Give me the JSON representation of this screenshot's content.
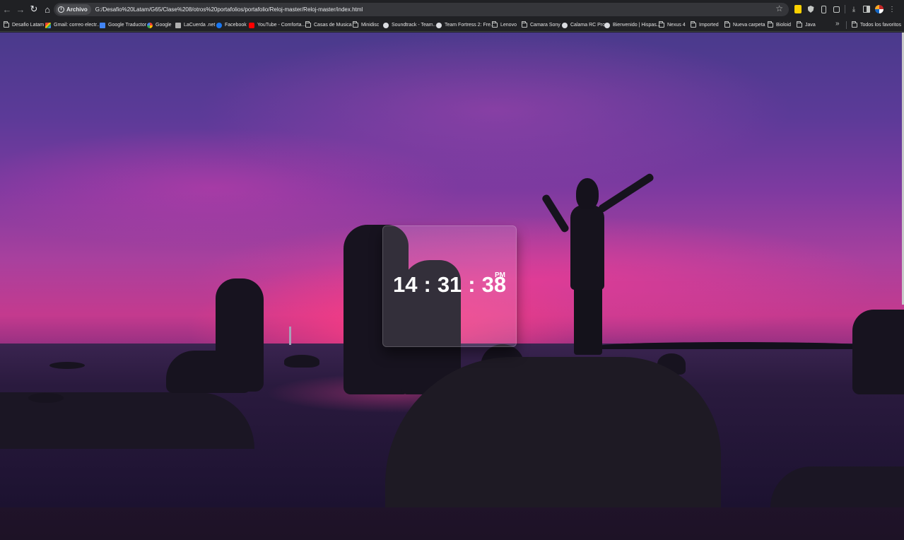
{
  "browser": {
    "chip_label": "Archivo",
    "url": "G:/Desafio%20Latam/G65/Clase%208/otros%20portafolios/portafolio/Reloj-master/Reloj-master/index.html"
  },
  "bookmarks": [
    {
      "label": "Desafio Latam",
      "icon": "folder-icon"
    },
    {
      "label": "Gmail: correo electr...",
      "icon": "gmail-icon"
    },
    {
      "label": "Google Traductor",
      "icon": "translate-icon"
    },
    {
      "label": "Google",
      "icon": "google-icon"
    },
    {
      "label": "LaCuerda .net",
      "icon": "lacuerda-icon"
    },
    {
      "label": "Facebook",
      "icon": "facebook-icon"
    },
    {
      "label": "YouTube - Comforta...",
      "icon": "youtube-icon"
    },
    {
      "label": "Casas de Musica",
      "icon": "folder-icon"
    },
    {
      "label": "Minidisc",
      "icon": "folder-icon"
    },
    {
      "label": "Soundtrack - Team...",
      "icon": "globe-icon"
    },
    {
      "label": "Team Fortress 2: Fre...",
      "icon": "globe-icon"
    },
    {
      "label": "Lenovo",
      "icon": "folder-icon"
    },
    {
      "label": "Camara Sony",
      "icon": "folder-icon"
    },
    {
      "label": "Calama RC Pro",
      "icon": "globe-icon"
    },
    {
      "label": "Bienvenido | Hispas...",
      "icon": "globe-icon"
    },
    {
      "label": "Nexus 4",
      "icon": "folder-icon"
    },
    {
      "label": "Imported",
      "icon": "folder-icon"
    },
    {
      "label": "Nueva carpeta",
      "icon": "folder-icon"
    },
    {
      "label": "Bioloid",
      "icon": "folder-icon"
    },
    {
      "label": "Java",
      "icon": "folder-icon"
    }
  ],
  "all_bookmarks_label": "Todos los favoritos",
  "clock": {
    "hours": "14",
    "minutes": "31",
    "seconds": "38",
    "separator": ":",
    "period": "PM"
  },
  "colors": {
    "chrome_bg": "#202124",
    "omnibox_bg": "#35363a",
    "clock_text": "#ffffff"
  }
}
